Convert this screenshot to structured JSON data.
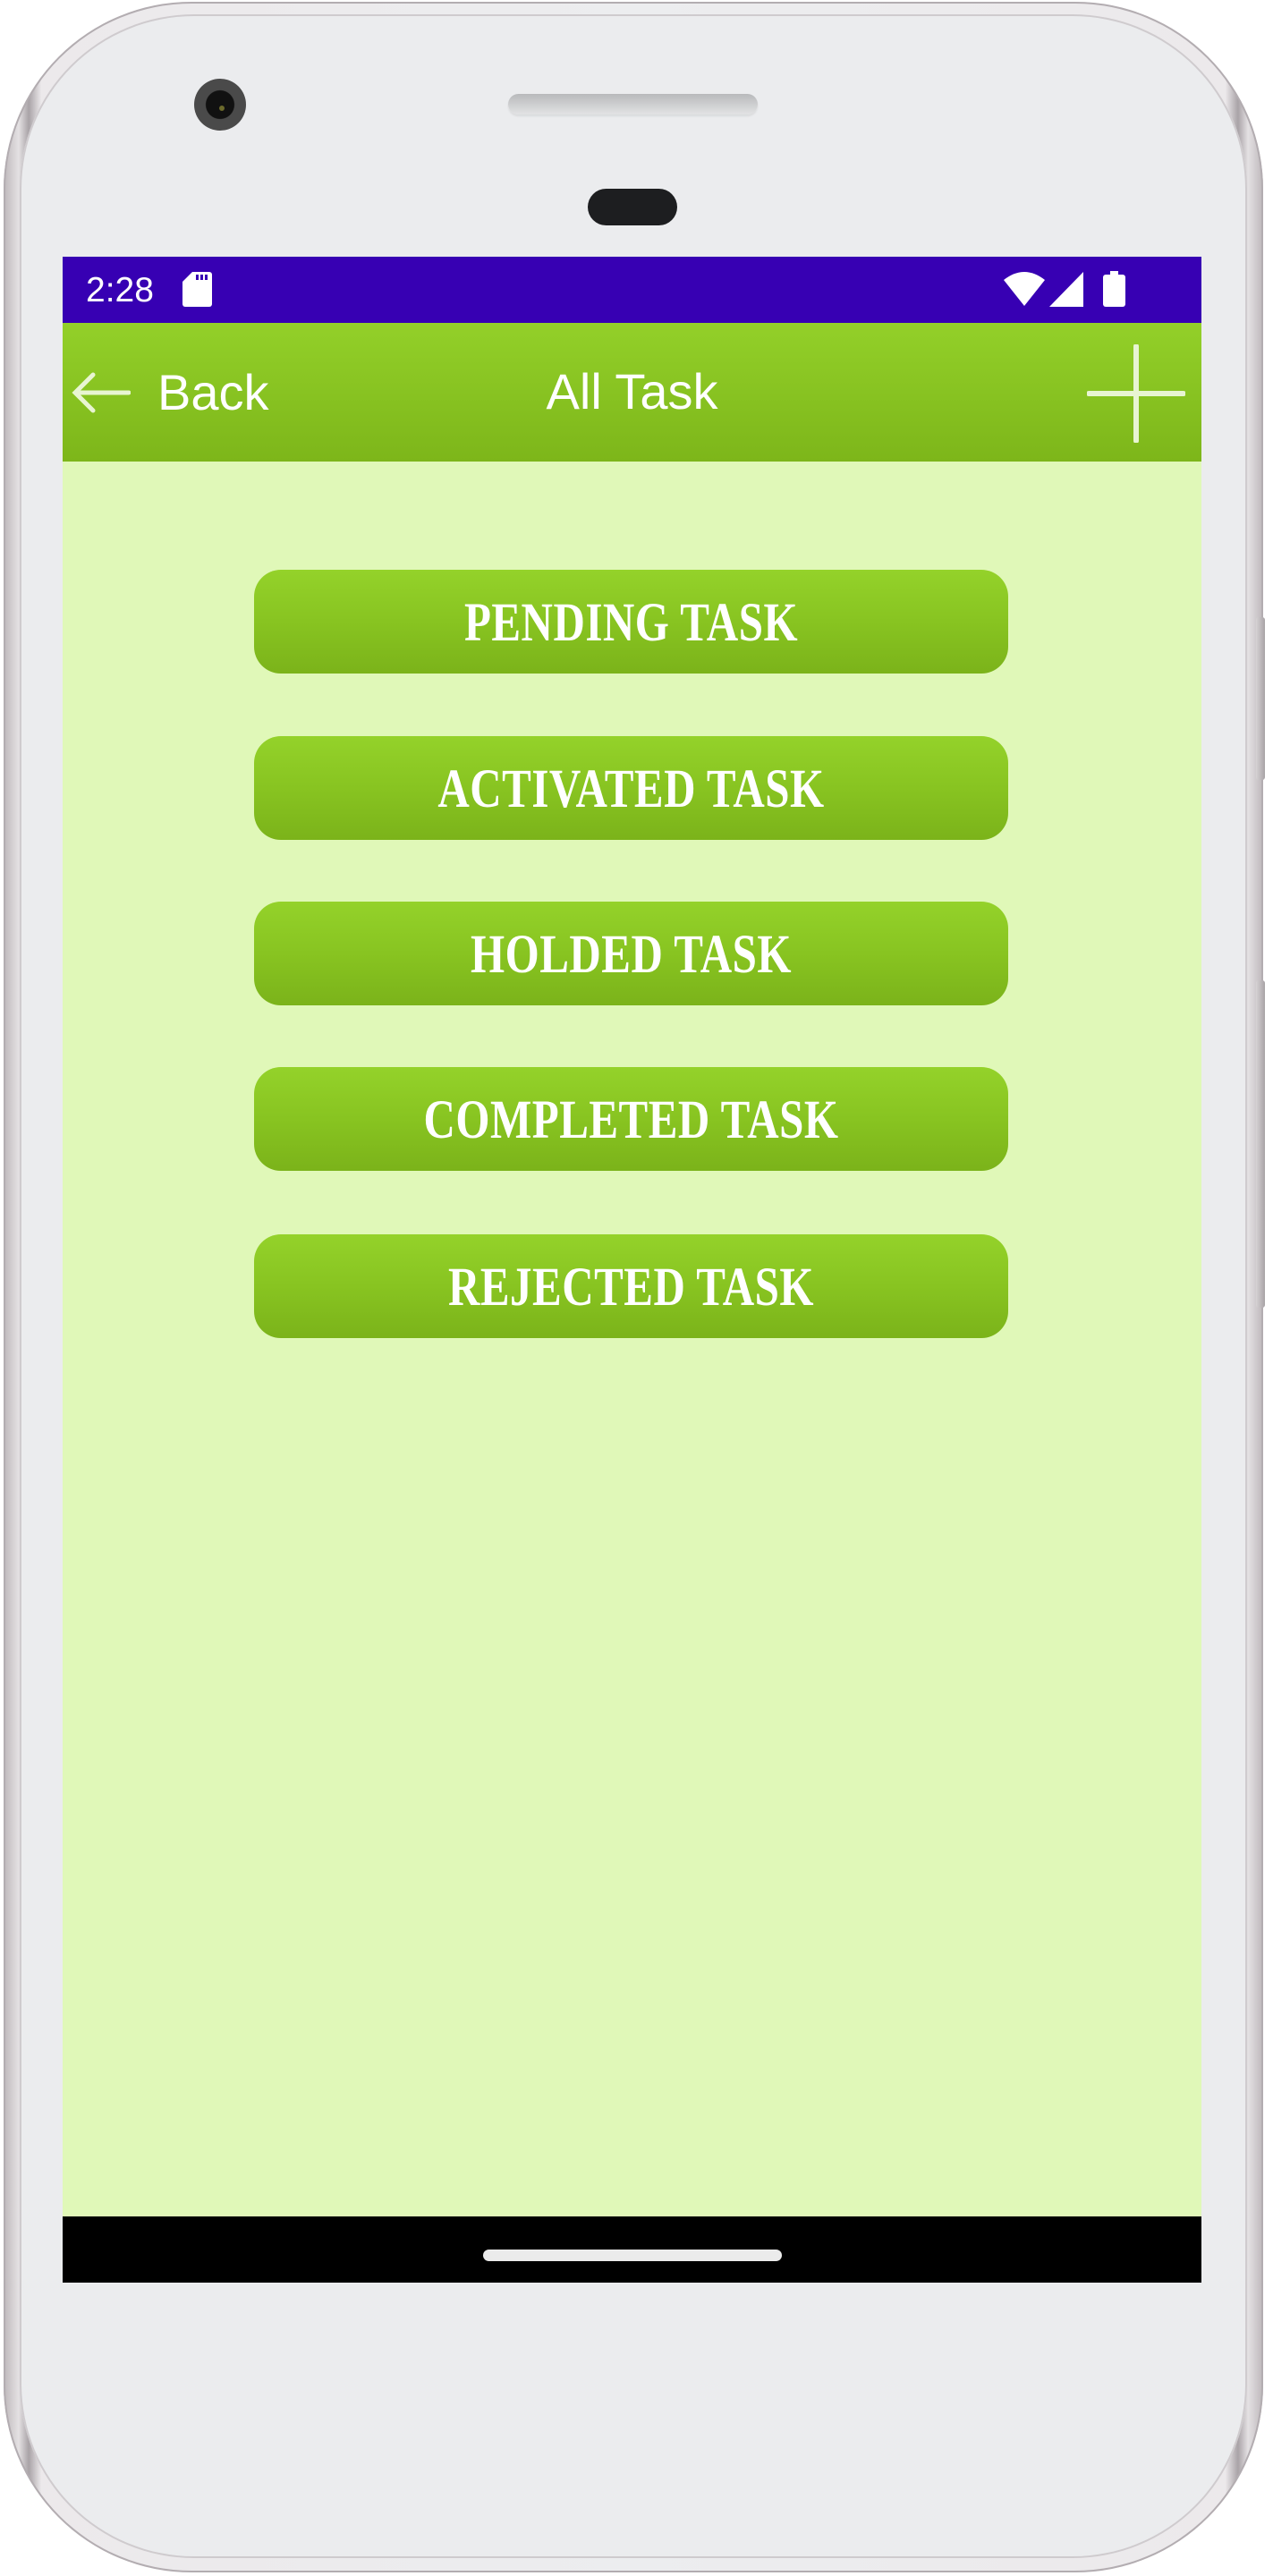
{
  "status_bar": {
    "time": "2:28",
    "left_icons": [
      "sd-card-icon"
    ],
    "right_icons": [
      "wifi-icon",
      "cell-signal-icon",
      "battery-icon"
    ],
    "background_color": "#3700b3"
  },
  "toolbar": {
    "back_label": "Back",
    "back_icon": "arrow-left-icon",
    "title": "All Task",
    "add_icon": "plus-icon",
    "gradient_colors": [
      "#93d029",
      "#7db61a"
    ]
  },
  "content": {
    "background_color": "#e0f8b8",
    "buttons": [
      {
        "label": "PENDING TASK"
      },
      {
        "label": "ACTIVATED TASK"
      },
      {
        "label": "HOLDED TASK"
      },
      {
        "label": "COMPLETED TASK"
      },
      {
        "label": "REJECTED TASK"
      }
    ]
  },
  "nav_bar": {
    "home_indicator": "home-gesture-pill"
  }
}
